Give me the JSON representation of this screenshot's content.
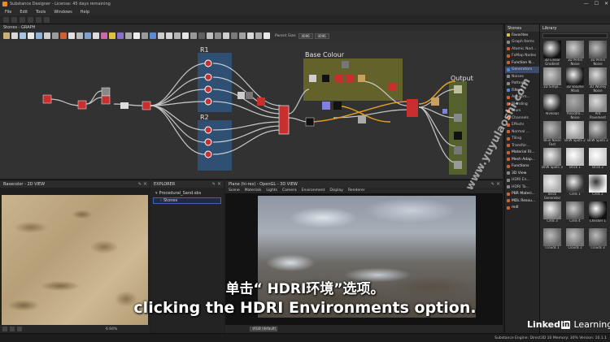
{
  "window": {
    "title": "Substance Designer - License: 45 days remaining",
    "controls": [
      "—",
      "☐",
      "✕"
    ]
  },
  "menu": [
    "File",
    "Edit",
    "Tools",
    "Windows",
    "Help"
  ],
  "graph": {
    "title": "Stones - GRAPH",
    "parent_size_label": "Parent Size:",
    "parent_size_value": "4096",
    "size_value": "4096",
    "frames": {
      "r1": "R1",
      "r2": "R2",
      "base_colour": "Base Colour",
      "output": "Output"
    }
  },
  "right_left_panel": {
    "tab": "Stones",
    "items": [
      {
        "label": "Favorites",
        "color": "#e0c040",
        "kind": "grp"
      },
      {
        "label": "Graph Items",
        "color": "#888888",
        "kind": "item"
      },
      {
        "label": "Atomic Nod...",
        "color": "#d06030",
        "kind": "item"
      },
      {
        "label": "FxMap Nodes",
        "color": "#d06030",
        "kind": "item"
      },
      {
        "label": "Function N...",
        "color": "#d06030",
        "kind": "grp"
      },
      {
        "label": "Generators",
        "color": "#4a8ad8",
        "kind": "sel"
      },
      {
        "label": "Noises",
        "color": "#888888",
        "kind": "item"
      },
      {
        "label": "Patterns",
        "color": "#888888",
        "kind": "item"
      },
      {
        "label": "Filters",
        "color": "#4a8ad8",
        "kind": "grp"
      },
      {
        "label": "Adjustm...",
        "color": "#d06030",
        "kind": "item"
      },
      {
        "label": "Blending",
        "color": "#d06030",
        "kind": "item"
      },
      {
        "label": "Blurs",
        "color": "#d06030",
        "kind": "item"
      },
      {
        "label": "Channels",
        "color": "#d06030",
        "kind": "item"
      },
      {
        "label": "Effects",
        "color": "#d06030",
        "kind": "item"
      },
      {
        "label": "Normal ...",
        "color": "#d06030",
        "kind": "item"
      },
      {
        "label": "Tiling",
        "color": "#d06030",
        "kind": "item"
      },
      {
        "label": "Transfor...",
        "color": "#d06030",
        "kind": "item"
      },
      {
        "label": "Material Fil...",
        "color": "#d06030",
        "kind": "grp"
      },
      {
        "label": "Mesh Adap...",
        "color": "#d06030",
        "kind": "grp"
      },
      {
        "label": "Functions",
        "color": "#d06030",
        "kind": "grp"
      },
      {
        "label": "3D View",
        "color": "#888888",
        "kind": "grp"
      },
      {
        "label": "HDRI En...",
        "color": "#888888",
        "kind": "item"
      },
      {
        "label": "HDRI To...",
        "color": "#888888",
        "kind": "item"
      },
      {
        "label": "PBR Materi...",
        "color": "#d06030",
        "kind": "grp"
      },
      {
        "label": "MDL Resou...",
        "color": "#d06030",
        "kind": "grp"
      },
      {
        "label": "mdl",
        "color": "#d06030",
        "kind": "grp"
      }
    ]
  },
  "library": {
    "tab": "Library",
    "thumbs": [
      {
        "label": "3D Linear Gradient",
        "bg": "#111111",
        "fg": "#eeeeee"
      },
      {
        "label": "3D Perlin Noise",
        "bg": "#666666",
        "fg": "#cfcfcf"
      },
      {
        "label": "3D Perlin Noise",
        "bg": "#555555",
        "fg": "#bbbbbb"
      },
      {
        "label": "3D Simpl...",
        "bg": "#777777",
        "fg": "#cccccc"
      },
      {
        "label": "3D Volume Mask",
        "bg": "#1a1a1a",
        "fg": "#f0f0f0"
      },
      {
        "label": "3D Worley Noise",
        "bg": "#6a6a6a",
        "fg": "#dddddd"
      },
      {
        "label": "Alveolus",
        "bg": "#222222",
        "fg": "#f5f5f5"
      },
      {
        "label": "Anisotro... Noise",
        "bg": "#777777",
        "fg": "#aaaaaa"
      },
      {
        "label": "Ant Pavement",
        "bg": "#888888",
        "fg": "#dddddd"
      },
      {
        "label": "Blue Noise Fast",
        "bg": "#666666",
        "fg": "#bbbbbb"
      },
      {
        "label": "BnW Spots 2",
        "bg": "#999999",
        "fg": "#e5e5e5"
      },
      {
        "label": "BnW Spots 2",
        "bg": "#5e5e5e",
        "fg": "#cccccc"
      },
      {
        "label": "BnW Spots 3",
        "bg": "#7a7a7a",
        "fg": "#eeeeee"
      },
      {
        "label": "Brick 1",
        "bg": "#bbbbbb",
        "fg": "#ffffff"
      },
      {
        "label": "Brick 2",
        "bg": "#cccccc",
        "fg": "#ffffff"
      },
      {
        "label": "Brick Generator",
        "bg": "#aaaaaa",
        "fg": "#eeeeee"
      },
      {
        "label": "Cells 1",
        "bg": "#333333",
        "fg": "#eeeeee"
      },
      {
        "label": "Cells 2",
        "bg": "#eeeeee",
        "fg": "#333333"
      },
      {
        "label": "Cells 3",
        "bg": "#777777",
        "fg": "#eeeeee"
      },
      {
        "label": "Cells 4",
        "bg": "#555555",
        "fg": "#cccccc"
      },
      {
        "label": "Checker 1",
        "bg": "#111111",
        "fg": "#ffffff"
      },
      {
        "label": "Clouds 1",
        "bg": "#666666",
        "fg": "#bbbbbb"
      },
      {
        "label": "Clouds 2",
        "bg": "#707070",
        "fg": "#c0c0c0"
      },
      {
        "label": "Clouds 3",
        "bg": "#5a5a5a",
        "fg": "#bbbbbb"
      }
    ]
  },
  "view2d": {
    "title": "Basecolor - 2D VIEW",
    "zoom": "6.94%"
  },
  "explorer": {
    "title": "EXPLORER",
    "package": "Procedural_Sand.sbs",
    "graph": "Stones"
  },
  "view3d": {
    "title": "Plane (hi-res) - OpenGL - 3D VIEW",
    "menu": [
      "Scene",
      "Materials",
      "Lights",
      "Camera",
      "Environment",
      "Display",
      "Renderer"
    ],
    "colorspace": "sRGB (default)"
  },
  "status": {
    "engine": "Substance Engine: Direct3D 10   Memory: 30%   Version: 10.1.1"
  },
  "overlay": {
    "subtitle_cn": "单击“ HDRI环境”选项。",
    "subtitle_en": "clicking the HDRI Environments option.",
    "watermark": "www.yuyulaoshi.com",
    "brand_linked": "Linked",
    "brand_in": "in",
    "brand_learning": "Learning"
  }
}
